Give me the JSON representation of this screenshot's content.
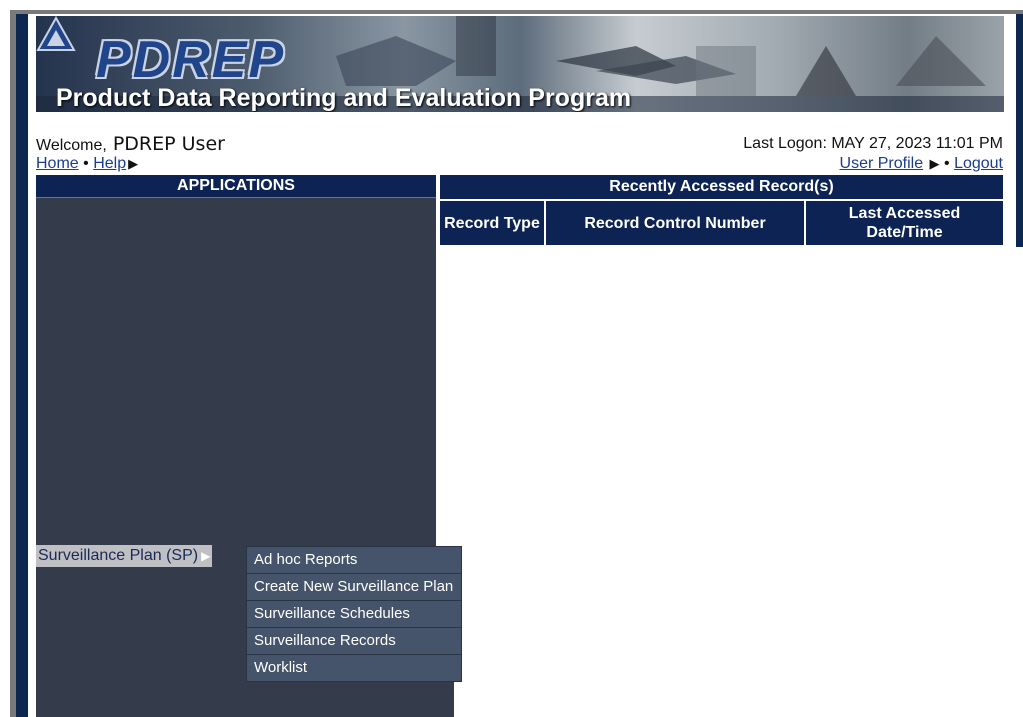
{
  "banner": {
    "logo_text": "PDREP",
    "program_title": "Product Data Reporting and Evaluation Program"
  },
  "welcome": {
    "label": "Welcome,",
    "user_name": "PDREP User",
    "last_logon": "Last Logon: MAY 27, 2023 11:01 PM"
  },
  "nav": {
    "home": "Home",
    "separator": "•",
    "help": "Help",
    "arrow": "▶",
    "user_profile": "User Profile",
    "logout": "Logout"
  },
  "applications": {
    "header": "APPLICATIONS",
    "items": [
      {
        "label": "Surveillance Plan (SP)",
        "arrow": "▶"
      }
    ],
    "submenu": [
      "Ad hoc Reports",
      "Create New Surveillance Plan",
      "Surveillance Schedules",
      "Surveillance Records",
      "Worklist"
    ]
  },
  "recent": {
    "header": "Recently Accessed Record(s)",
    "columns": [
      "Record Type",
      "Record Control Number",
      "Last Accessed Date/Time"
    ],
    "rows": []
  },
  "colors": {
    "navy": "#0c2353",
    "panel": "#343c4c",
    "submenu": "#45546a",
    "link": "#1a3d8f"
  }
}
